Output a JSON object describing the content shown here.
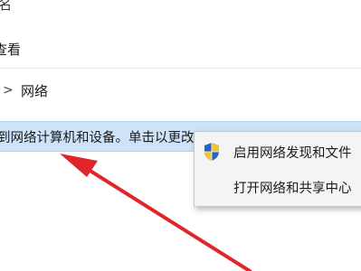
{
  "window": {
    "title_fragment": "名"
  },
  "menu_bar": {
    "view_label": "查看"
  },
  "address_bar": {
    "chevron": ">",
    "path": "网络"
  },
  "info_bar": {
    "text": "到网络计算机和设备。单击以更改..."
  },
  "context_menu": {
    "items": [
      {
        "label": "启用网络发现和文件",
        "icon": "uac-shield-icon"
      },
      {
        "label": "打开网络和共享中心"
      }
    ]
  },
  "annotation": {
    "type": "arrow",
    "color": "#e0262a"
  }
}
